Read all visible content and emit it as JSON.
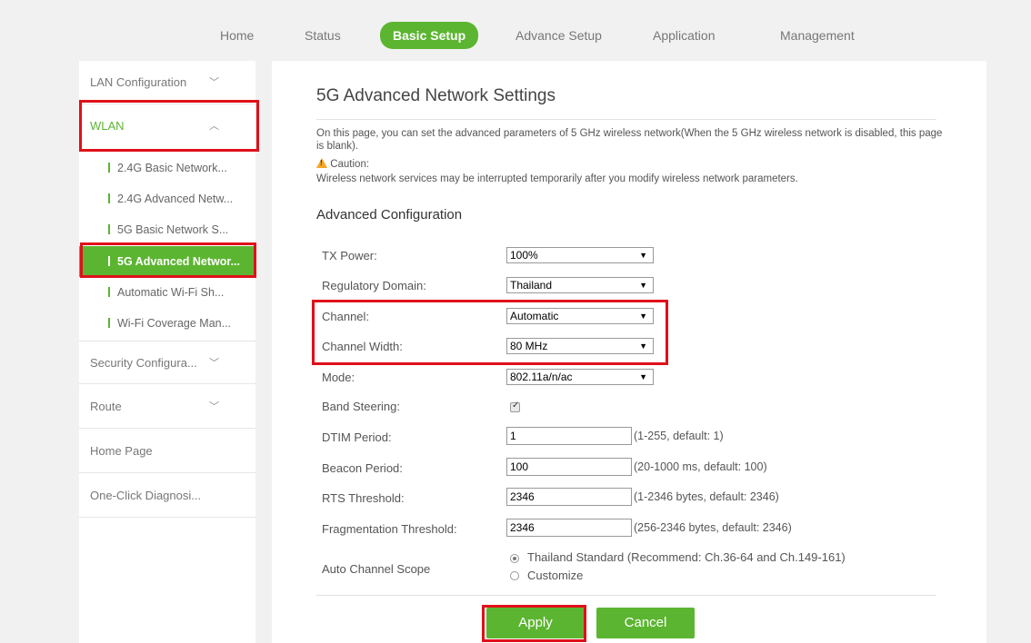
{
  "topnav": {
    "items": [
      "Home",
      "Status",
      "Basic Setup",
      "Advance Setup",
      "Application",
      "Management"
    ],
    "active": "Basic Setup"
  },
  "sidebar": {
    "lan": "LAN Configuration",
    "wlan": "WLAN",
    "sub": [
      "2.4G Basic Network...",
      "2.4G Advanced Netw...",
      "5G Basic Network S...",
      "5G Advanced Networ...",
      "Automatic Wi-Fi Sh...",
      "Wi-Fi Coverage Man..."
    ],
    "security": "Security Configura...",
    "route": "Route",
    "home_page": "Home Page",
    "diagnosis": "One-Click Diagnosi..."
  },
  "main": {
    "title": "5G Advanced Network Settings",
    "desc": "On this page, you can set the advanced parameters of 5 GHz wireless network(When the 5 GHz wireless network is disabled, this page is blank).",
    "caution": "Caution:",
    "warning": "Wireless network services may be interrupted temporarily after you modify wireless network parameters.",
    "section": "Advanced Configuration",
    "fields": {
      "tx_power": {
        "label": "TX Power:",
        "value": "100%"
      },
      "regulatory": {
        "label": "Regulatory Domain:",
        "value": "Thailand"
      },
      "channel": {
        "label": "Channel:",
        "value": "Automatic"
      },
      "channel_width": {
        "label": "Channel Width:",
        "value": "80 MHz"
      },
      "mode": {
        "label": "Mode:",
        "value": "802.11a/n/ac"
      },
      "band_steering": {
        "label": "Band Steering:",
        "checked": true
      },
      "dtim": {
        "label": "DTIM Period:",
        "value": "1",
        "hint": "(1-255, default: 1)"
      },
      "beacon": {
        "label": "Beacon Period:",
        "value": "100",
        "hint": "(20-1000 ms, default: 100)"
      },
      "rts": {
        "label": "RTS Threshold:",
        "value": "2346",
        "hint": "(1-2346 bytes, default: 2346)"
      },
      "frag": {
        "label": "Fragmentation Threshold:",
        "value": "2346",
        "hint": "(256-2346 bytes, default: 2346)"
      },
      "scope": {
        "label": "Auto Channel Scope",
        "opt1": "Thailand Standard (Recommend: Ch.36-64 and Ch.149-161)",
        "opt2": "Customize",
        "selected": "opt1"
      }
    },
    "apply": "Apply",
    "cancel": "Cancel"
  },
  "colors": {
    "accent": "#5cb531",
    "highlight": "#e0101a"
  }
}
